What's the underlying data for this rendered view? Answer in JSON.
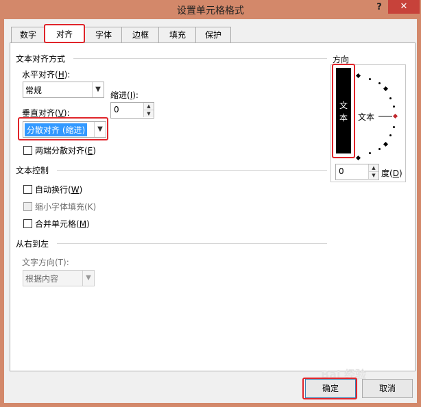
{
  "window": {
    "title": "设置单元格格式",
    "help": "?",
    "close": "✕"
  },
  "tabs": [
    {
      "label": "数字"
    },
    {
      "label": "对齐"
    },
    {
      "label": "字体"
    },
    {
      "label": "边框"
    },
    {
      "label": "填充"
    },
    {
      "label": "保护"
    }
  ],
  "text_align": {
    "title": "文本对齐方式",
    "horizontal_label": "水平对齐(",
    "horizontal_key": "H",
    "horizontal_tail": "):",
    "horizontal_value": "常规",
    "indent_label": "缩进(",
    "indent_key": "I",
    "indent_tail": "):",
    "indent_value": "0",
    "vertical_label": "垂直对齐(",
    "vertical_key": "V",
    "vertical_tail": "):",
    "vertical_value": "分散对齐 (缩进)",
    "justify_distributed_label": "两端分散对齐(",
    "justify_distributed_key": "E",
    "justify_distributed_tail": ")"
  },
  "text_control": {
    "title": "文本控制",
    "wrap_label": "自动换行(",
    "wrap_key": "W",
    "wrap_tail": ")",
    "shrink_label": "缩小字体填充(K)",
    "merge_label": "合并单元格(",
    "merge_key": "M",
    "merge_tail": ")"
  },
  "rtl": {
    "title": "从右到左",
    "direction_label": "文字方向(T):",
    "direction_value": "根据内容"
  },
  "orientation": {
    "title": "方向",
    "vertical_text": [
      "文",
      "本"
    ],
    "text_label": "文本",
    "degrees_value": "0",
    "degrees_label": "度(",
    "degrees_key": "D",
    "degrees_tail": ")"
  },
  "buttons": {
    "ok": "确定",
    "cancel": "取消"
  },
  "watermark": "Bai 经验",
  "colors": {
    "title_bar": "#d3886a",
    "highlight": "#e0242a",
    "selection": "#3399ff"
  }
}
